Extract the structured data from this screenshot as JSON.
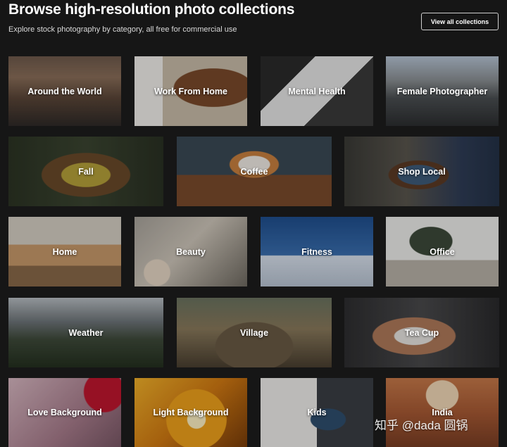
{
  "header": {
    "title": "Browse high-resolution photo collections",
    "subtitle": "Explore stock photography by category, all free for commercial use",
    "view_all_label": "View all collections"
  },
  "collections": [
    {
      "label": "Around the World"
    },
    {
      "label": "Work From Home"
    },
    {
      "label": "Mental Health"
    },
    {
      "label": "Female Photographer"
    },
    {
      "label": "Fall"
    },
    {
      "label": "Coffee"
    },
    {
      "label": "Shop Local"
    },
    {
      "label": "Home"
    },
    {
      "label": "Beauty"
    },
    {
      "label": "Fitness"
    },
    {
      "label": "Office"
    },
    {
      "label": "Weather"
    },
    {
      "label": "Village"
    },
    {
      "label": "Tea Cup"
    },
    {
      "label": "Love Background"
    },
    {
      "label": "Light Background"
    },
    {
      "label": "Kids"
    },
    {
      "label": "India"
    }
  ],
  "watermark": "知乎 @dada 圆锅",
  "colors": {
    "page_background": "#161616",
    "text": "#ffffff",
    "button_border": "#cfcfcf"
  }
}
